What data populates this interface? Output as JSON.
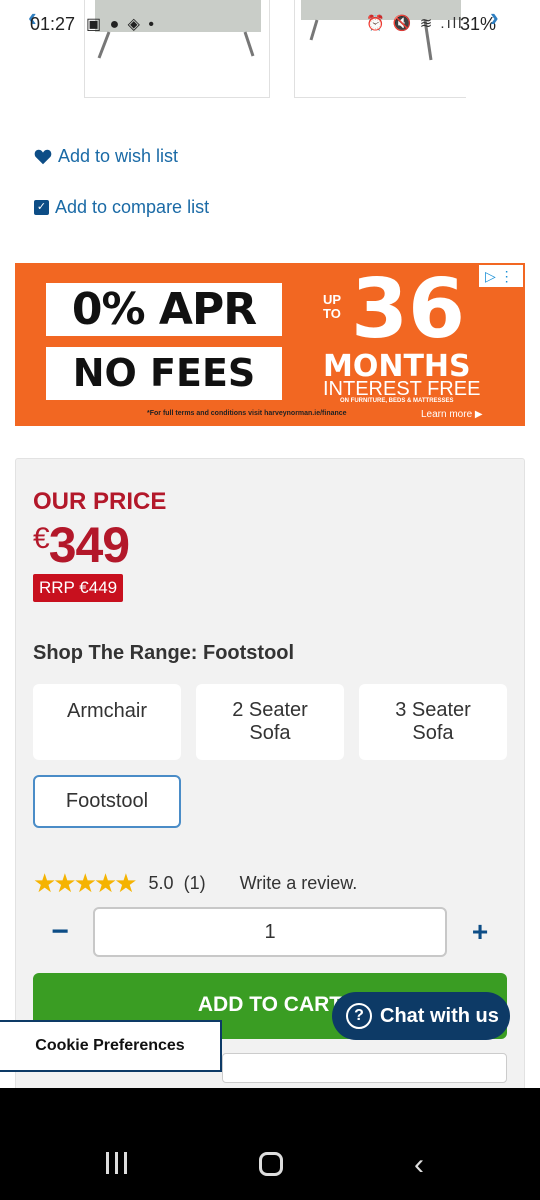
{
  "status_bar": {
    "time": "01:27",
    "left_icons": "▣ ● ◈ •",
    "right_icons": "⏰ 🔇 ≋ .ıll",
    "battery": "31%"
  },
  "gallery": {
    "prev_arrow": "‹",
    "next_arrow": "›"
  },
  "links": {
    "wish": "Add to wish list",
    "compare": "Add to compare list"
  },
  "ad": {
    "line1": "0% APR",
    "line2": "NO FEES",
    "up_to": "UP\nTO",
    "number": "36",
    "months": "MONTHS",
    "interest": "INTEREST FREE",
    "furniture": "ON FURNITURE, BEDS & MATTRESSES",
    "terms": "*For full terms and conditions visit harveynorman.ie/finance",
    "learn_more": "Learn more ▶",
    "adchoices": "▷ ⋮"
  },
  "pricing": {
    "label": "OUR PRICE",
    "currency": "€",
    "amount": "349",
    "rrp": "RRP €449"
  },
  "range": {
    "title": "Shop The Range: Footstool",
    "options": [
      "Armchair",
      "2 Seater Sofa",
      "3 Seater Sofa",
      "Footstool"
    ],
    "selected": "Footstool"
  },
  "rating": {
    "stars": "★★★★★",
    "score": "5.0",
    "count": "(1)",
    "write_review": "Write a review."
  },
  "quantity": {
    "minus": "−",
    "value": "1",
    "plus": "+"
  },
  "cart": {
    "button": "ADD TO CART"
  },
  "chat": {
    "icon": "?",
    "label": "Chat with us"
  },
  "cookie": {
    "label": "Cookie Preferences"
  },
  "colors": {
    "price_red": "#b3182a",
    "ad_orange": "#f26722",
    "cart_green": "#3a9d23",
    "navy": "#0d3a66"
  }
}
